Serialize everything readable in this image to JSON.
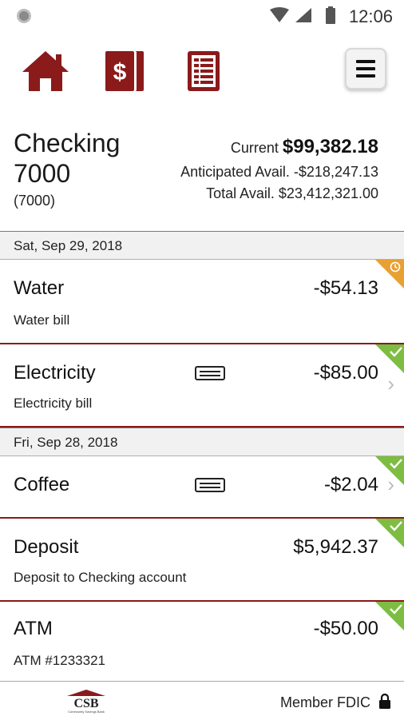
{
  "status_bar": {
    "time": "12:06"
  },
  "toolbar": {
    "icons": [
      "home-icon",
      "dollar-card-icon",
      "statement-icon",
      "menu-icon"
    ],
    "brand_color": "#8b1a1a"
  },
  "account": {
    "name": "Checking 7000",
    "number": "(7000)",
    "current_label": "Current",
    "current_value": "$99,382.18",
    "anticipated_label": "Anticipated Avail.",
    "anticipated_value": "-$218,247.13",
    "total_label": "Total Avail.",
    "total_value": "$23,412,321.00"
  },
  "dates": [
    "Sat, Sep 29, 2018",
    "Fri, Sep 28, 2018"
  ],
  "transactions": [
    {
      "title": "Water",
      "amount": "-$54.13",
      "desc": "Water bill",
      "status": "pending"
    },
    {
      "title": "Electricity",
      "amount": "-$85.00",
      "desc": "Electricity bill",
      "status": "cleared"
    },
    {
      "title": "Coffee",
      "amount": "-$2.04",
      "desc": "",
      "status": "cleared"
    },
    {
      "title": "Deposit",
      "amount": "$5,942.37",
      "desc": "Deposit to Checking account",
      "status": "cleared"
    },
    {
      "title": "ATM",
      "amount": "-$50.00",
      "desc": "ATM #1233321",
      "status": "cleared"
    }
  ],
  "status_colors": {
    "cleared": "#7cbd42",
    "pending": "#e8a032"
  },
  "footer": {
    "logo_text": "CSB",
    "logo_subtext": "Community Savings Bank",
    "fdic": "Member FDIC"
  }
}
